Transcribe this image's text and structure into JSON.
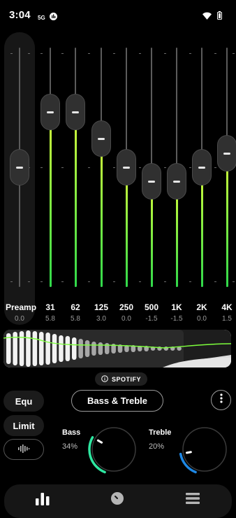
{
  "status_bar": {
    "time": "3:04",
    "icons": [
      "sim-icon",
      "equalizer-app-icon",
      "wifi-icon",
      "battery-icon"
    ]
  },
  "preamp": {
    "label": "Preamp",
    "value": "0.0"
  },
  "bands": [
    {
      "label": "31",
      "value": "5.8"
    },
    {
      "label": "62",
      "value": "5.8"
    },
    {
      "label": "125",
      "value": "3.0"
    },
    {
      "label": "250",
      "value": "0.0"
    },
    {
      "label": "500",
      "value": "-1.5"
    },
    {
      "label": "1K",
      "value": "-1.5"
    },
    {
      "label": "2K",
      "value": "0.0"
    },
    {
      "label": "4K",
      "value": "1.5"
    }
  ],
  "source_chip": {
    "label": "SPOTIFY"
  },
  "side_buttons": {
    "equ": "Equ",
    "limit": "Limit"
  },
  "mode_button": {
    "label": "Bass & Treble"
  },
  "bass": {
    "label": "Bass",
    "value": "34%",
    "level": 0.34
  },
  "treble": {
    "label": "Treble",
    "value": "20%",
    "level": 0.2
  },
  "colors": {
    "accent_green": "#7dff3c",
    "accent_blue": "#1e88e5",
    "accent_teal": "#2ee6a0"
  },
  "bottom_nav": [
    "equalizer-bars-icon",
    "dial-icon",
    "menu-icon"
  ]
}
